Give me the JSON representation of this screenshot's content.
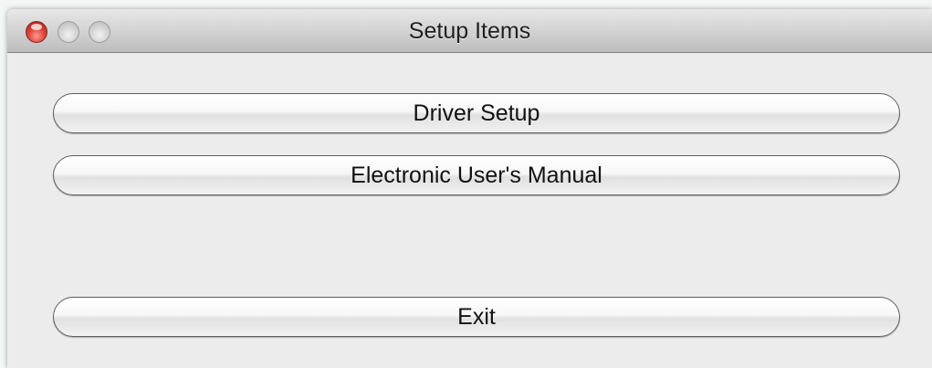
{
  "window": {
    "title": "Setup Items"
  },
  "buttons": {
    "driver_setup": "Driver Setup",
    "user_manual": "Electronic User's Manual",
    "exit": "Exit"
  },
  "colors": {
    "window_background": "#ececec",
    "close_button": "#e0463a",
    "inactive_traffic_light": "#d2d2d2",
    "button_border": "#5e5e5e"
  }
}
